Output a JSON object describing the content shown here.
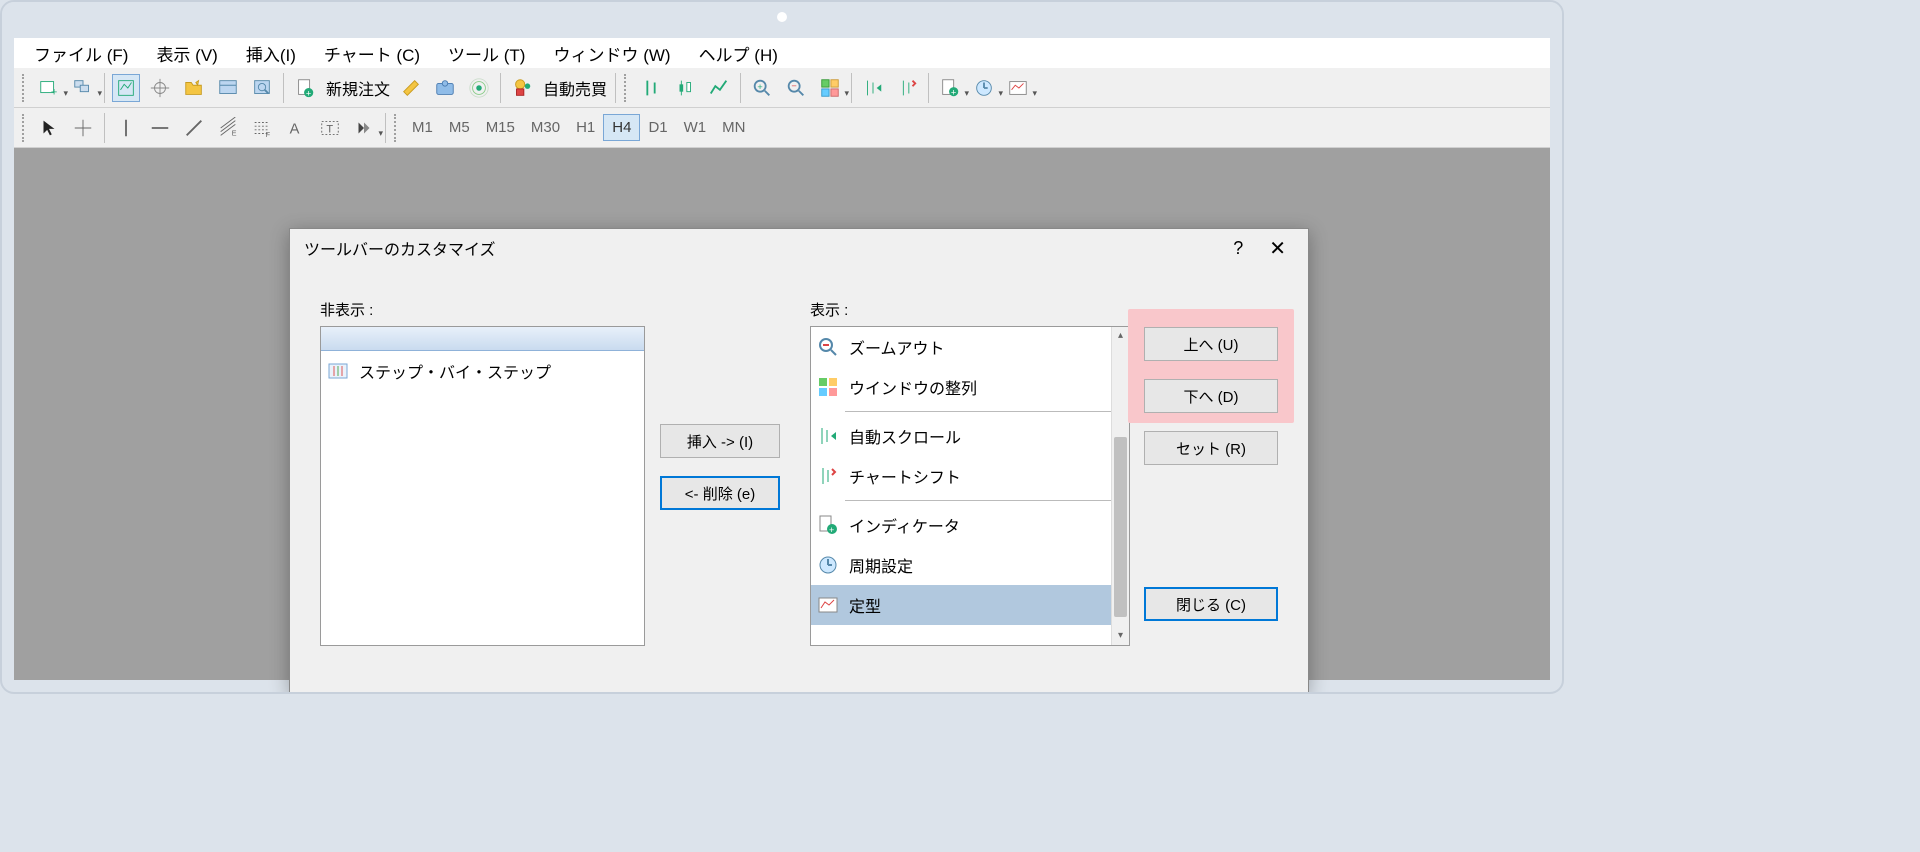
{
  "menu": {
    "file": "ファイル (F)",
    "view": "表示 (V)",
    "insert": "挿入(I)",
    "chart": "チャート (C)",
    "tool": "ツール (T)",
    "window": "ウィンドウ (W)",
    "help": "ヘルプ (H)"
  },
  "toolbar1": {
    "new_order": "新規注文",
    "auto_trade": "自動売買"
  },
  "timeframes": [
    "M1",
    "M5",
    "M15",
    "M30",
    "H1",
    "H4",
    "D1",
    "W1",
    "MN"
  ],
  "timeframe_selected": "H4",
  "dialog": {
    "title": "ツールバーのカスタマイズ",
    "hidden_label": "非表示 :",
    "shown_label": "表示 :",
    "hidden_items": [
      "ステップ・バイ・ステップ"
    ],
    "shown_items": [
      {
        "label": "ズームアウト",
        "sep": false
      },
      {
        "label": "ウインドウの整列",
        "sep": false
      },
      {
        "label": "自動スクロール",
        "sep": true
      },
      {
        "label": "チャートシフト",
        "sep": false
      },
      {
        "label": "インディケータ",
        "sep": true
      },
      {
        "label": "周期設定",
        "sep": false
      },
      {
        "label": "定型",
        "sep": false,
        "selected": true
      }
    ],
    "insert_btn": "挿入 -> (I)",
    "delete_btn": "<- 削除 (e)",
    "up_btn": "上へ (U)",
    "down_btn": "下へ (D)",
    "reset_btn": "セット (R)",
    "close_btn": "閉じる (C)"
  }
}
